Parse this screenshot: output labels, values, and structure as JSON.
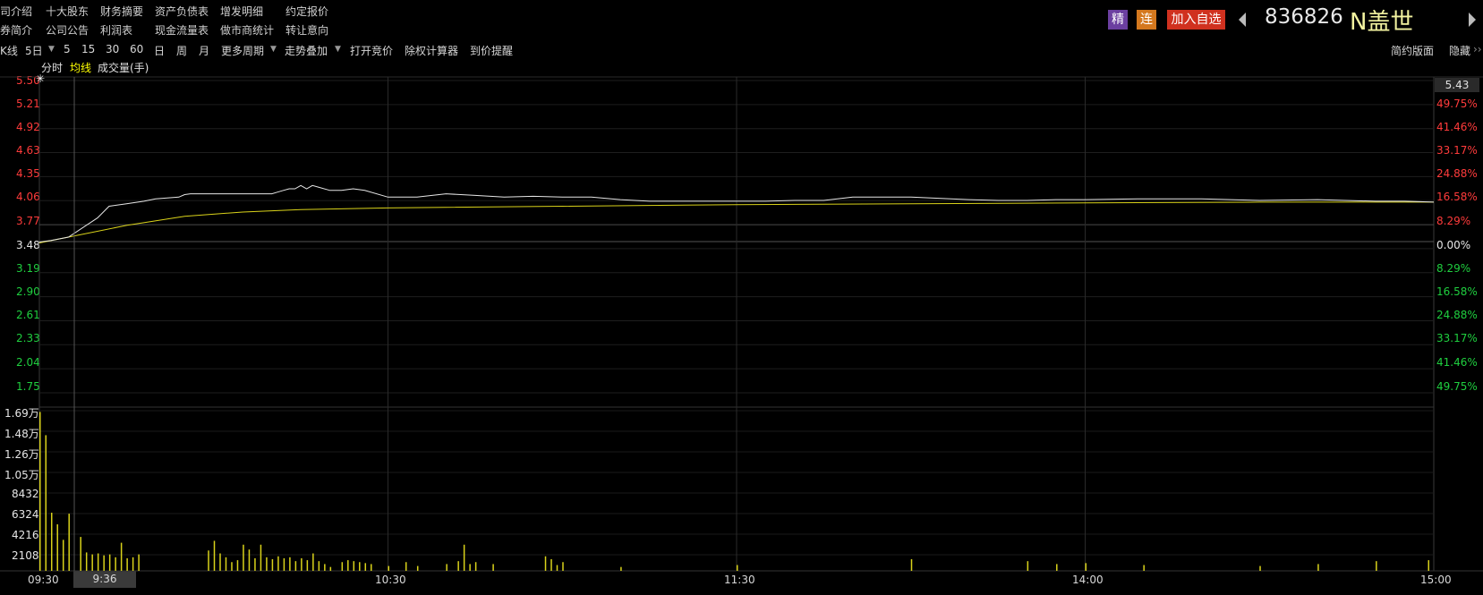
{
  "top_menu": {
    "row1": [
      "司介绍",
      "十大股东",
      "财务摘要",
      "资产负债表",
      "增发明细",
      "约定报价"
    ],
    "row2": [
      "券简介",
      "公司公告",
      "利润表",
      "现金流量表",
      "做市商统计",
      "转让意向"
    ]
  },
  "header": {
    "badge_jing": "精",
    "badge_lian": "连",
    "add_watchlist": "加入自选",
    "code": "836826",
    "name": "N盖世",
    "colors": {
      "jing": "#6b3fa0",
      "lian": "#d4781e",
      "add": "#d0311f",
      "name": "#f3f3a0"
    }
  },
  "toolbar": {
    "items": [
      "K线",
      "5日",
      "5",
      "15",
      "30",
      "60",
      "日",
      "周",
      "月",
      "更多周期",
      "走势叠加",
      "打开竞价",
      "除权计算器",
      "到价提醒"
    ],
    "right_items": [
      "简约版面",
      "隐藏"
    ]
  },
  "legend": {
    "fenshi": "分时",
    "junxian": "均线",
    "volume": "成交量(手)"
  },
  "price_axis": {
    "left": [
      "5.50",
      "5.21",
      "4.92",
      "4.63",
      "4.35",
      "4.06",
      "3.77",
      "3.48",
      "3.19",
      "2.90",
      "2.61",
      "2.33",
      "2.04",
      "1.75"
    ],
    "right": [
      "5.43",
      "49.75%",
      "41.46%",
      "33.17%",
      "24.88%",
      "16.58%",
      "8.29%",
      "0.00%",
      "8.29%",
      "16.58%",
      "24.88%",
      "33.17%",
      "41.46%",
      "49.75%"
    ]
  },
  "volume_axis": [
    "1.69万",
    "1.48万",
    "1.26万",
    "1.05万",
    "8432",
    "6324",
    "4216",
    "2108"
  ],
  "time_axis": [
    "09:30",
    "9:36",
    "10:30",
    "11:30",
    "14:00",
    "15:00"
  ],
  "chart_data": {
    "type": "line",
    "ylim": [
      1.75,
      5.5
    ],
    "prev_close": 3.48,
    "series": [
      {
        "name": "分时",
        "x": [
          0,
          2,
          5,
          10,
          12,
          15,
          18,
          20,
          22,
          24,
          25,
          26,
          27,
          29,
          30,
          34,
          38,
          40,
          41,
          42,
          43,
          44,
          45,
          46,
          47,
          48,
          50,
          52,
          54,
          56,
          60,
          65,
          70,
          75,
          80,
          85,
          90,
          95,
          100,
          105,
          110,
          115,
          120,
          125,
          130,
          135,
          140,
          150,
          160,
          165,
          170,
          175,
          180,
          190,
          200,
          210,
          220,
          230,
          235,
          240
        ],
        "y": [
          3.56,
          3.58,
          3.62,
          3.85,
          3.99,
          4.02,
          4.05,
          4.08,
          4.09,
          4.1,
          4.13,
          4.14,
          4.14,
          4.14,
          4.14,
          4.14,
          4.14,
          4.14,
          4.16,
          4.18,
          4.2,
          4.2,
          4.24,
          4.2,
          4.24,
          4.22,
          4.18,
          4.18,
          4.2,
          4.18,
          4.1,
          4.1,
          4.14,
          4.12,
          4.1,
          4.11,
          4.1,
          4.1,
          4.07,
          4.05,
          4.05,
          4.05,
          4.05,
          4.05,
          4.06,
          4.06,
          4.1,
          4.1,
          4.07,
          4.06,
          4.06,
          4.07,
          4.07,
          4.08,
          4.08,
          4.06,
          4.07,
          4.05,
          4.05,
          4.04
        ]
      },
      {
        "name": "均线",
        "x": [
          0,
          5,
          15,
          25,
          35,
          45,
          60,
          90,
          120,
          150,
          180,
          210,
          240
        ],
        "y": [
          3.55,
          3.62,
          3.76,
          3.87,
          3.92,
          3.95,
          3.97,
          3.99,
          4.01,
          4.02,
          4.03,
          4.04,
          4.04
        ]
      }
    ],
    "volume": {
      "name": "成交量(手)",
      "x": [
        0,
        1,
        2,
        3,
        4,
        5,
        7,
        8,
        9,
        10,
        11,
        12,
        13,
        14,
        15,
        16,
        17,
        29,
        30,
        31,
        32,
        33,
        34,
        35,
        36,
        37,
        38,
        39,
        40,
        41,
        42,
        43,
        44,
        45,
        46,
        47,
        48,
        49,
        50,
        52,
        53,
        54,
        55,
        56,
        57,
        60,
        63,
        65,
        70,
        72,
        73,
        74,
        75,
        78,
        87,
        88,
        89,
        90,
        100,
        120,
        150,
        170,
        175,
        180,
        190,
        210,
        220,
        230,
        239
      ],
      "v": [
        16400,
        14000,
        6000,
        4800,
        3200,
        5900,
        3500,
        1900,
        1700,
        1800,
        1600,
        1700,
        1400,
        2900,
        1300,
        1400,
        1700,
        2100,
        3100,
        1800,
        1400,
        900,
        1100,
        2700,
        2200,
        1300,
        2700,
        1400,
        1200,
        1500,
        1300,
        1400,
        1000,
        1300,
        1100,
        1800,
        1000,
        700,
        400,
        900,
        1100,
        1000,
        900,
        800,
        700,
        500,
        900,
        500,
        700,
        1000,
        2700,
        700,
        900,
        700,
        1500,
        1200,
        600,
        900,
        400,
        600,
        1200,
        1000,
        700,
        800,
        600,
        500,
        700,
        1000,
        1100
      ]
    },
    "x_ticks": [
      "09:30",
      "10:30",
      "11:30",
      "14:00",
      "15:00"
    ],
    "current_price": "5.43"
  }
}
